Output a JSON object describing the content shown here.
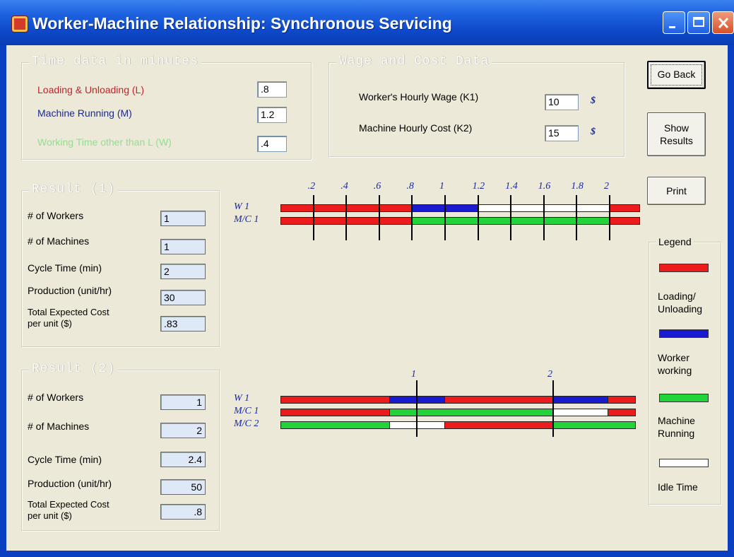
{
  "window": {
    "title": "Worker-Machine Relationship: Synchronous Servicing"
  },
  "time_data": {
    "group_title": "Time data in minutes",
    "loading_label": "Loading & Unloading (L)",
    "loading_value": ".8",
    "machine_label": "Machine Running (M)",
    "machine_value": "1.2",
    "working_label": "Working Time other than L (W)",
    "working_value": ".4",
    "colors": {
      "loading": "#c8202a",
      "machine": "#1c2a8a",
      "working": "#8fe08f"
    }
  },
  "wage_data": {
    "group_title": "Wage and Cost Data",
    "wage_label": "Worker's Hourly Wage (K1)",
    "wage_value": "10",
    "wage_unit": "$",
    "cost_label": "Machine Hourly Cost (K2)",
    "cost_value": "15",
    "cost_unit": "$"
  },
  "buttons": {
    "go_back": "Go Back",
    "show_line1": "Show",
    "show_line2": "Results",
    "print": "Print"
  },
  "result1": {
    "group_title": "Result (1)",
    "workers_label": "# of Workers",
    "workers_value": "1",
    "machines_label": "# of Machines",
    "machines_value": "1",
    "cycle_label": "Cycle Time (min)",
    "cycle_value": "2",
    "production_label": "Production (unit/hr)",
    "production_value": "30",
    "cost_label_1": "Total Expected Cost",
    "cost_label_2": "per unit ($)",
    "cost_value": ".83"
  },
  "result2": {
    "group_title": "Result (2)",
    "workers_label": "# of Workers",
    "workers_value": "1",
    "machines_label": "# of Machines",
    "machines_value": "2",
    "cycle_label": "Cycle Time (min)",
    "cycle_value": "2.4",
    "production_label": "Production (unit/hr)",
    "production_value": "50",
    "cost_label_1": "Total Expected Cost",
    "cost_label_2": "per unit ($)",
    "cost_value": ".8"
  },
  "legend": {
    "title": "Legend",
    "loading_1": "Loading/",
    "loading_2": "Unloading",
    "worker_1": "Worker",
    "worker_2": "working",
    "machine_1": "Machine",
    "machine_2": "Running",
    "idle": "Idle Time"
  },
  "gantt1": {
    "tick_labels": [
      ".2",
      ".4",
      ".6",
      ".8",
      "1",
      "1.2",
      "1.4",
      "1.6",
      "1.8",
      "2"
    ],
    "rows": [
      {
        "label": "W 1",
        "segments": [
          {
            "color": "red",
            "start": 0,
            "end": 0.8
          },
          {
            "color": "blue",
            "start": 0.8,
            "end": 1.2
          },
          {
            "color": "white",
            "start": 1.2,
            "end": 2.0
          },
          {
            "color": "red",
            "start": 2.0,
            "end": 2.18
          }
        ]
      },
      {
        "label": "M/C 1",
        "segments": [
          {
            "color": "red",
            "start": 0,
            "end": 0.8
          },
          {
            "color": "green",
            "start": 0.8,
            "end": 2.0
          },
          {
            "color": "red",
            "start": 2.0,
            "end": 2.18
          }
        ]
      }
    ]
  },
  "gantt2": {
    "tick_labels": [
      "1",
      "2"
    ],
    "rows": [
      {
        "label": "W 1",
        "segments": [
          {
            "color": "red",
            "start": 0,
            "end": 0.8
          },
          {
            "color": "blue",
            "start": 0.8,
            "end": 1.2
          },
          {
            "color": "red",
            "start": 1.2,
            "end": 2.0
          },
          {
            "color": "blue",
            "start": 2.0,
            "end": 2.4
          },
          {
            "color": "red",
            "start": 2.4,
            "end": 2.6
          }
        ]
      },
      {
        "label": "M/C 1",
        "segments": [
          {
            "color": "red",
            "start": 0,
            "end": 0.8
          },
          {
            "color": "green",
            "start": 0.8,
            "end": 2.0
          },
          {
            "color": "white",
            "start": 2.0,
            "end": 2.4
          },
          {
            "color": "red",
            "start": 2.4,
            "end": 2.6
          }
        ]
      },
      {
        "label": "M/C 2",
        "segments": [
          {
            "color": "green",
            "start": 0,
            "end": 0.8
          },
          {
            "color": "white",
            "start": 0.8,
            "end": 1.2
          },
          {
            "color": "red",
            "start": 1.2,
            "end": 2.0
          },
          {
            "color": "green",
            "start": 2.0,
            "end": 2.6
          }
        ]
      }
    ]
  }
}
